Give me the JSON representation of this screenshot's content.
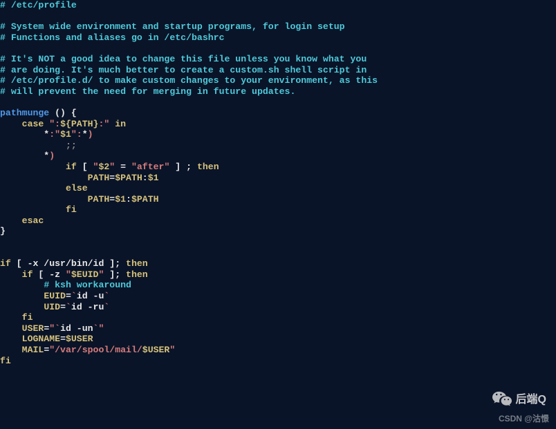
{
  "code": {
    "lines": [
      [
        [
          "comment",
          "#"
        ],
        [
          "white",
          " "
        ],
        [
          "comment",
          "/etc/profile"
        ]
      ],
      [
        [
          "white",
          ""
        ]
      ],
      [
        [
          "comment",
          "#"
        ],
        [
          "white",
          " "
        ],
        [
          "comment",
          "System wide environment and startup programs, for login setup"
        ]
      ],
      [
        [
          "comment",
          "#"
        ],
        [
          "white",
          " "
        ],
        [
          "comment",
          "Functions and aliases go in /etc/bashrc"
        ]
      ],
      [
        [
          "white",
          ""
        ]
      ],
      [
        [
          "comment",
          "#"
        ],
        [
          "white",
          " "
        ],
        [
          "comment",
          "It's NOT a good idea to change this file unless you know what you"
        ]
      ],
      [
        [
          "comment",
          "#"
        ],
        [
          "white",
          " "
        ],
        [
          "comment",
          "are doing. It's much better to create a custom.sh shell script in"
        ]
      ],
      [
        [
          "comment",
          "#"
        ],
        [
          "white",
          " "
        ],
        [
          "comment",
          "/etc/profile.d/ to make custom changes to your environment, as this"
        ]
      ],
      [
        [
          "comment",
          "#"
        ],
        [
          "white",
          " "
        ],
        [
          "comment",
          "will prevent the need for merging in future updates."
        ]
      ],
      [
        [
          "white",
          ""
        ]
      ],
      [
        [
          "ident",
          "pathmunge "
        ],
        [
          "white",
          "() {"
        ]
      ],
      [
        [
          "white",
          "    "
        ],
        [
          "var",
          "case "
        ],
        [
          "str",
          "\":"
        ],
        [
          "var",
          "${PATH}"
        ],
        [
          "str",
          ":\""
        ],
        [
          "var",
          " in"
        ]
      ],
      [
        [
          "white",
          "        *"
        ],
        [
          "str",
          ":\""
        ],
        [
          "var",
          "$1"
        ],
        [
          "str",
          "\":"
        ],
        [
          "white",
          "*"
        ],
        [
          "str",
          ")"
        ]
      ],
      [
        [
          "white",
          "            "
        ],
        [
          "grey",
          ";;"
        ]
      ],
      [
        [
          "white",
          "        *"
        ],
        [
          "str",
          ")"
        ]
      ],
      [
        [
          "white",
          "            "
        ],
        [
          "var",
          "if"
        ],
        [
          "white",
          " [ "
        ],
        [
          "str",
          "\""
        ],
        [
          "var",
          "$2"
        ],
        [
          "str",
          "\""
        ],
        [
          "white",
          " = "
        ],
        [
          "str",
          "\"after\""
        ],
        [
          "white",
          " ] ; "
        ],
        [
          "var",
          "then"
        ]
      ],
      [
        [
          "white",
          "                "
        ],
        [
          "var",
          "PATH"
        ],
        [
          "white",
          "="
        ],
        [
          "var",
          "$PATH"
        ],
        [
          "white",
          ":"
        ],
        [
          "var",
          "$1"
        ]
      ],
      [
        [
          "white",
          "            "
        ],
        [
          "var",
          "else"
        ]
      ],
      [
        [
          "white",
          "                "
        ],
        [
          "var",
          "PATH"
        ],
        [
          "white",
          "="
        ],
        [
          "var",
          "$1"
        ],
        [
          "white",
          ":"
        ],
        [
          "var",
          "$PATH"
        ]
      ],
      [
        [
          "white",
          "            "
        ],
        [
          "var",
          "fi"
        ]
      ],
      [
        [
          "white",
          "    "
        ],
        [
          "var",
          "esac"
        ]
      ],
      [
        [
          "white",
          "}"
        ]
      ],
      [
        [
          "white",
          ""
        ]
      ],
      [
        [
          "white",
          ""
        ]
      ],
      [
        [
          "var",
          "if"
        ],
        [
          "white",
          " [ -x /usr/bin/id ]; "
        ],
        [
          "var",
          "then"
        ]
      ],
      [
        [
          "white",
          "    "
        ],
        [
          "var",
          "if"
        ],
        [
          "white",
          " [ -z "
        ],
        [
          "str",
          "\""
        ],
        [
          "var",
          "$EUID"
        ],
        [
          "str",
          "\""
        ],
        [
          "white",
          " ]; "
        ],
        [
          "var",
          "then"
        ]
      ],
      [
        [
          "white",
          "        "
        ],
        [
          "comment",
          "# ksh workaround"
        ]
      ],
      [
        [
          "white",
          "        "
        ],
        [
          "var",
          "EUID"
        ],
        [
          "white",
          "="
        ],
        [
          "str",
          "`"
        ],
        [
          "white",
          "id -u"
        ],
        [
          "str",
          "`"
        ]
      ],
      [
        [
          "white",
          "        "
        ],
        [
          "var",
          "UID"
        ],
        [
          "white",
          "="
        ],
        [
          "str",
          "`"
        ],
        [
          "white",
          "id -ru"
        ],
        [
          "str",
          "`"
        ]
      ],
      [
        [
          "white",
          "    "
        ],
        [
          "var",
          "fi"
        ]
      ],
      [
        [
          "white",
          "    "
        ],
        [
          "var",
          "USER"
        ],
        [
          "white",
          "="
        ],
        [
          "str",
          "\"`"
        ],
        [
          "white",
          "id -un"
        ],
        [
          "str",
          "`\""
        ]
      ],
      [
        [
          "white",
          "    "
        ],
        [
          "var",
          "LOGNAME"
        ],
        [
          "white",
          "="
        ],
        [
          "var",
          "$USER"
        ]
      ],
      [
        [
          "white",
          "    "
        ],
        [
          "var",
          "MAIL"
        ],
        [
          "white",
          "="
        ],
        [
          "str",
          "\"/var/spool/mail/"
        ],
        [
          "var",
          "$USER"
        ],
        [
          "str",
          "\""
        ]
      ],
      [
        [
          "var",
          "fi"
        ]
      ]
    ]
  },
  "watermark": {
    "text": "后端Q",
    "attrib": "CSDN @沽憬"
  }
}
